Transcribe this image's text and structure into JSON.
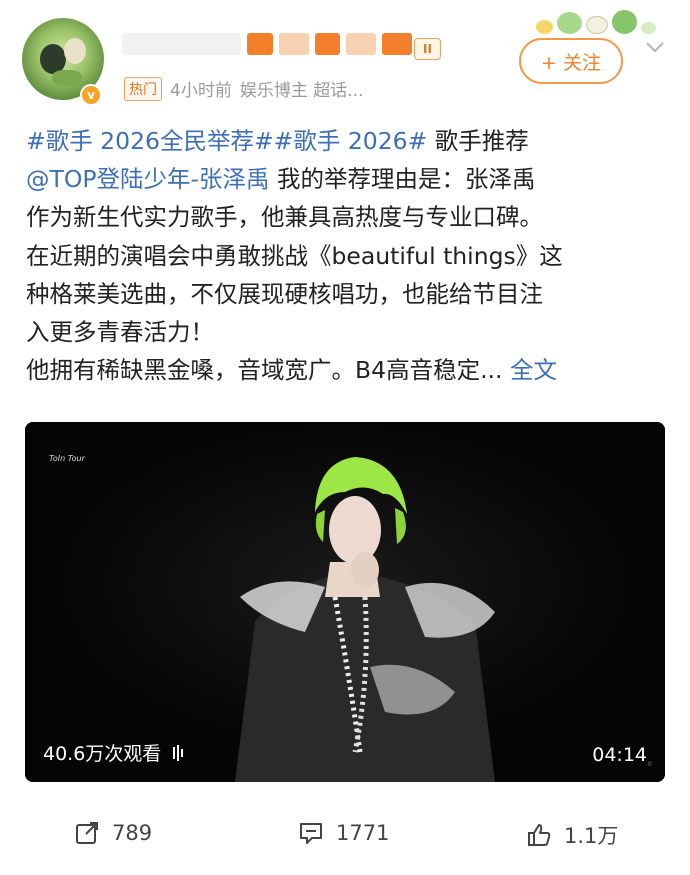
{
  "header": {
    "username": "",
    "level_badge": "II",
    "hot_label": "热门",
    "time": "4小时前",
    "source": "娱乐博主 超话...",
    "follow_label": "+ 关注"
  },
  "post": {
    "lines": [
      [
        {
          "t": "#歌手 2026全民举荐##歌手 2026#",
          "link": true
        },
        {
          "t": " 歌手推荐",
          "link": false
        }
      ],
      [
        {
          "t": "@TOP登陆少年-张泽禹",
          "link": true
        },
        {
          "t": " 我的举荐理由是：张泽禹",
          "link": false
        }
      ],
      [
        {
          "t": "作为新生代实力歌手，他兼具高热度与专业口碑。",
          "link": false
        }
      ],
      [
        {
          "t": "在近期的演唱会中勇敢挑战《beautiful things》这",
          "link": false
        }
      ],
      [
        {
          "t": "种格莱美选曲，不仅展现硬核唱功，也能给节目注",
          "link": false
        }
      ],
      [
        {
          "t": "入更多青春活力！",
          "link": false
        }
      ],
      [
        {
          "t": "他拥有稀缺黑金嗓，音域宽广。B4高音稳定... ",
          "link": false
        },
        {
          "t": "全文",
          "link": true
        }
      ]
    ]
  },
  "video": {
    "watermark": "ToIn Tour",
    "views": "40.6万次观看",
    "duration": "04:14"
  },
  "footer": {
    "repost": "789",
    "comment": "1771",
    "like": "1.1万"
  },
  "colors": {
    "link": "#3d6fb6",
    "accent": "#f0822d"
  }
}
